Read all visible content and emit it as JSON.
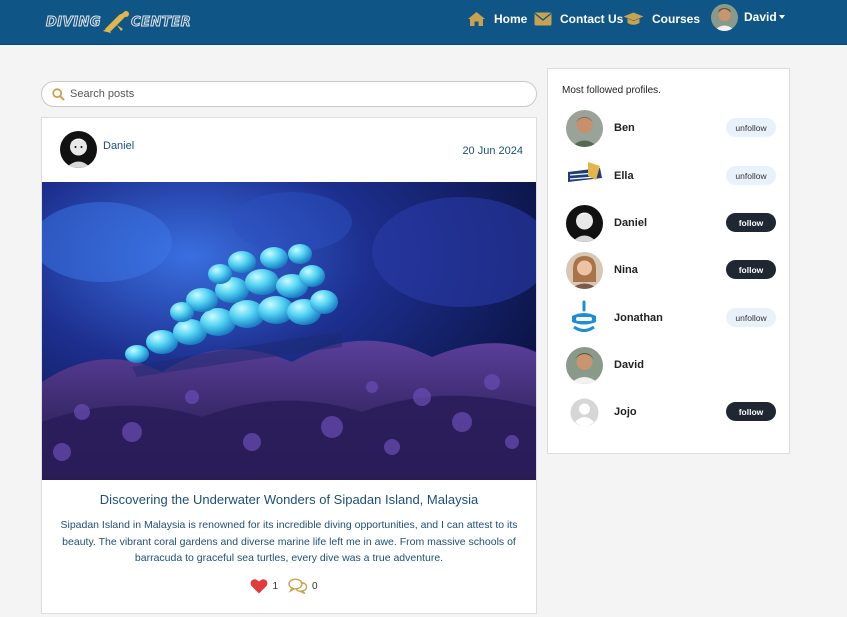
{
  "brand": {
    "logo_text_left": "DIVING",
    "logo_text_right": "CENTER"
  },
  "nav": {
    "home": "Home",
    "contact": "Contact Us",
    "courses": "Courses",
    "user": "David"
  },
  "search": {
    "placeholder": "Search posts"
  },
  "post": {
    "author": "Daniel",
    "date": "20 Jun 2024",
    "title": "Discovering the Underwater Wonders of Sipadan Island, Malaysia",
    "body": "Sipadan Island in Malaysia is renowned for its incredible diving opportunities, and I can attest to its beauty. The vibrant coral gardens and diverse marine life left me in awe. From massive schools of barracuda to graceful sea turtles, every dive was a true adventure.",
    "likes": "1",
    "comments": "0"
  },
  "sidebar": {
    "title": "Most followed profiles.",
    "profiles": [
      {
        "name": "Ben",
        "action": "unfollow"
      },
      {
        "name": "Ella",
        "action": "unfollow"
      },
      {
        "name": "Daniel",
        "action": "follow"
      },
      {
        "name": "Nina",
        "action": "follow"
      },
      {
        "name": "Jonathan",
        "action": "unfollow"
      },
      {
        "name": "David",
        "action": ""
      },
      {
        "name": "Jojo",
        "action": "follow"
      }
    ]
  },
  "colors": {
    "navbar": "#0f5687",
    "accent_gold": "#c9a24f",
    "link_blue": "#1d4f77",
    "heart": "#e23b3b",
    "follow_dark": "#1f2733",
    "unfollow_light": "#e9f2fb"
  }
}
